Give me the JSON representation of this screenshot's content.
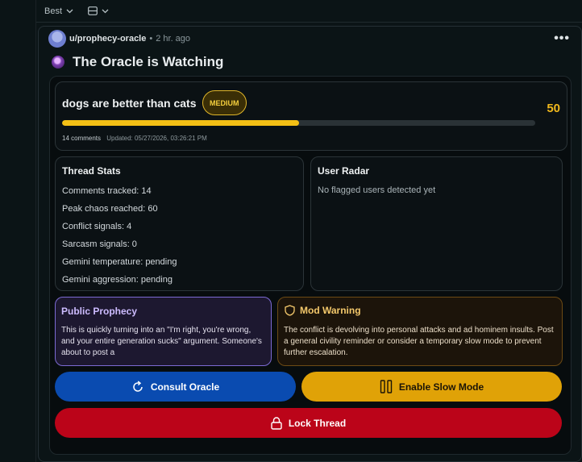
{
  "sort_bar": {
    "sort_label": "Best"
  },
  "post": {
    "username": "u/prophecy-oracle",
    "separator": "•",
    "time": "2 hr. ago",
    "more": "•••",
    "title": "The Oracle is Watching"
  },
  "topic": {
    "text": "dogs are better than cats",
    "level": "MEDIUM",
    "score": "50",
    "progress_percent": 50,
    "comments": "14 comments",
    "updated": "Updated: 05/27/2026, 03:26:21 PM"
  },
  "thread_stats": {
    "title": "Thread Stats",
    "lines": [
      "Comments tracked: 14",
      "Peak chaos reached: 60",
      "Conflict signals: 4",
      "Sarcasm signals: 0",
      "Gemini temperature: pending",
      "Gemini aggression: pending"
    ]
  },
  "user_radar": {
    "title": "User Radar",
    "empty": "No flagged users detected yet"
  },
  "prophecy": {
    "title": "Public Prophecy",
    "text": "This is quickly turning into an \"I'm right, you're wrong, and your entire generation sucks\" argument. Someone's about to post a"
  },
  "mod_warning": {
    "title": "Mod Warning",
    "text": "The conflict is devolving into personal attacks and ad hominem insults. Post a general civility reminder or consider a temporary slow mode to prevent further escalation."
  },
  "buttons": {
    "consult": "Consult Oracle",
    "slow": "Enable Slow Mode",
    "lock": "Lock Thread"
  },
  "colors": {
    "accent_yellow": "#f4c015",
    "consult_blue": "#0a4bb0",
    "slow_amber": "#e0a207",
    "lock_red": "#bb0419"
  }
}
